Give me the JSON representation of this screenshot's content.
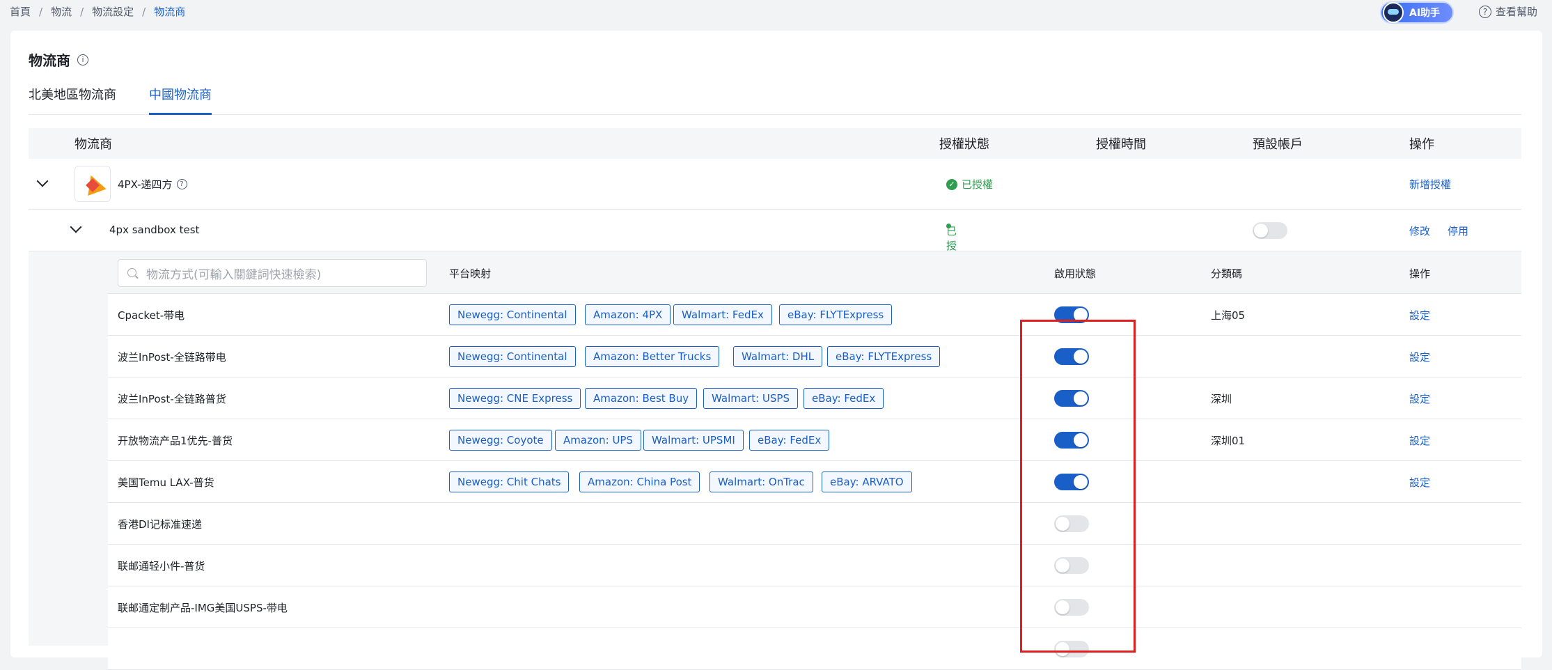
{
  "breadcrumb": [
    "首頁",
    "物流",
    "物流設定",
    "物流商"
  ],
  "ai_assistant": {
    "label": "AI助手"
  },
  "help": {
    "label": "查看幫助"
  },
  "page_title": "物流商",
  "tabs": [
    {
      "label": "北美地區物流商",
      "active": false
    },
    {
      "label": "中國物流商",
      "active": true
    }
  ],
  "table_header": {
    "carrier": "物流商",
    "auth_status": "授權狀態",
    "auth_time": "授權時間",
    "default_account": "預設帳戶",
    "actions": "操作"
  },
  "carrier": {
    "name": "4PX-递四方",
    "auth_status": "已授權",
    "action": "新增授權"
  },
  "account": {
    "name": "4px sandbox test",
    "auth_status": "已授權",
    "default_enabled": false,
    "edit": "修改",
    "disable": "停用"
  },
  "methods_header": {
    "search_placeholder": "物流方式(可輸入關鍵詞快速檢索)",
    "mapping": "平台映射",
    "enabled": "啟用狀態",
    "code": "分類碼",
    "actions": "操作"
  },
  "methods": [
    {
      "name": "Cpacket-带电",
      "tags": [
        "Newegg: Continental",
        "Amazon: 4PX",
        "Walmart: FedEx",
        "eBay: FLYTExpress"
      ],
      "enabled": true,
      "code": "上海05",
      "action": "設定"
    },
    {
      "name": "波兰InPost-全链路带电",
      "tags": [
        "Newegg: Continental",
        "Amazon: Better Trucks",
        "Walmart: DHL",
        "eBay: FLYTExpress"
      ],
      "enabled": true,
      "code": "",
      "action": "設定"
    },
    {
      "name": "波兰InPost-全链路普货",
      "tags": [
        "Newegg: CNE Express",
        "Amazon: Best Buy",
        "Walmart: USPS",
        "eBay: FedEx"
      ],
      "enabled": true,
      "code": "深圳",
      "action": "設定"
    },
    {
      "name": "开放物流产品1优先-普货",
      "tags": [
        "Newegg: Coyote",
        "Amazon: UPS",
        "Walmart: UPSMI",
        "eBay: FedEx"
      ],
      "enabled": true,
      "code": "深圳01",
      "action": "設定"
    },
    {
      "name": "美国Temu LAX-普货",
      "tags": [
        "Newegg: Chit Chats",
        "Amazon: China Post",
        "Walmart: OnTrac",
        "eBay: ARVATO"
      ],
      "enabled": true,
      "code": "",
      "action": "設定"
    },
    {
      "name": "香港DI记标准速递",
      "tags": [],
      "enabled": false,
      "code": "",
      "action": ""
    },
    {
      "name": "联邮通轻小件-普货",
      "tags": [],
      "enabled": false,
      "code": "",
      "action": ""
    },
    {
      "name": "联邮通定制产品-IMG美国USPS-带电",
      "tags": [],
      "enabled": false,
      "code": "",
      "action": ""
    },
    {
      "name": "",
      "tags": [],
      "enabled": false,
      "code": "",
      "action": ""
    }
  ]
}
